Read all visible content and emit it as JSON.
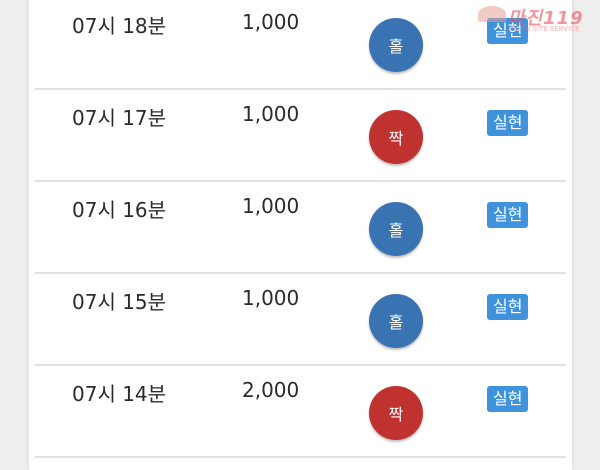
{
  "colors": {
    "odd": "#3a73b2",
    "even": "#c0322f",
    "badge": "#3f93dd"
  },
  "rows": [
    {
      "time": "07시 18분",
      "amount": "1,000",
      "result": "홀",
      "result_type": "odd",
      "status": "실현"
    },
    {
      "time": "07시 17분",
      "amount": "1,000",
      "result": "짝",
      "result_type": "even",
      "status": "실현"
    },
    {
      "time": "07시 16분",
      "amount": "1,000",
      "result": "홀",
      "result_type": "odd",
      "status": "실현"
    },
    {
      "time": "07시 15분",
      "amount": "1,000",
      "result": "홀",
      "result_type": "odd",
      "status": "실현"
    },
    {
      "time": "07시 14분",
      "amount": "2,000",
      "result": "짝",
      "result_type": "even",
      "status": "실현"
    }
  ],
  "watermark": {
    "text": "마진119",
    "subtext": "MAJIN SITE SERVICE"
  }
}
